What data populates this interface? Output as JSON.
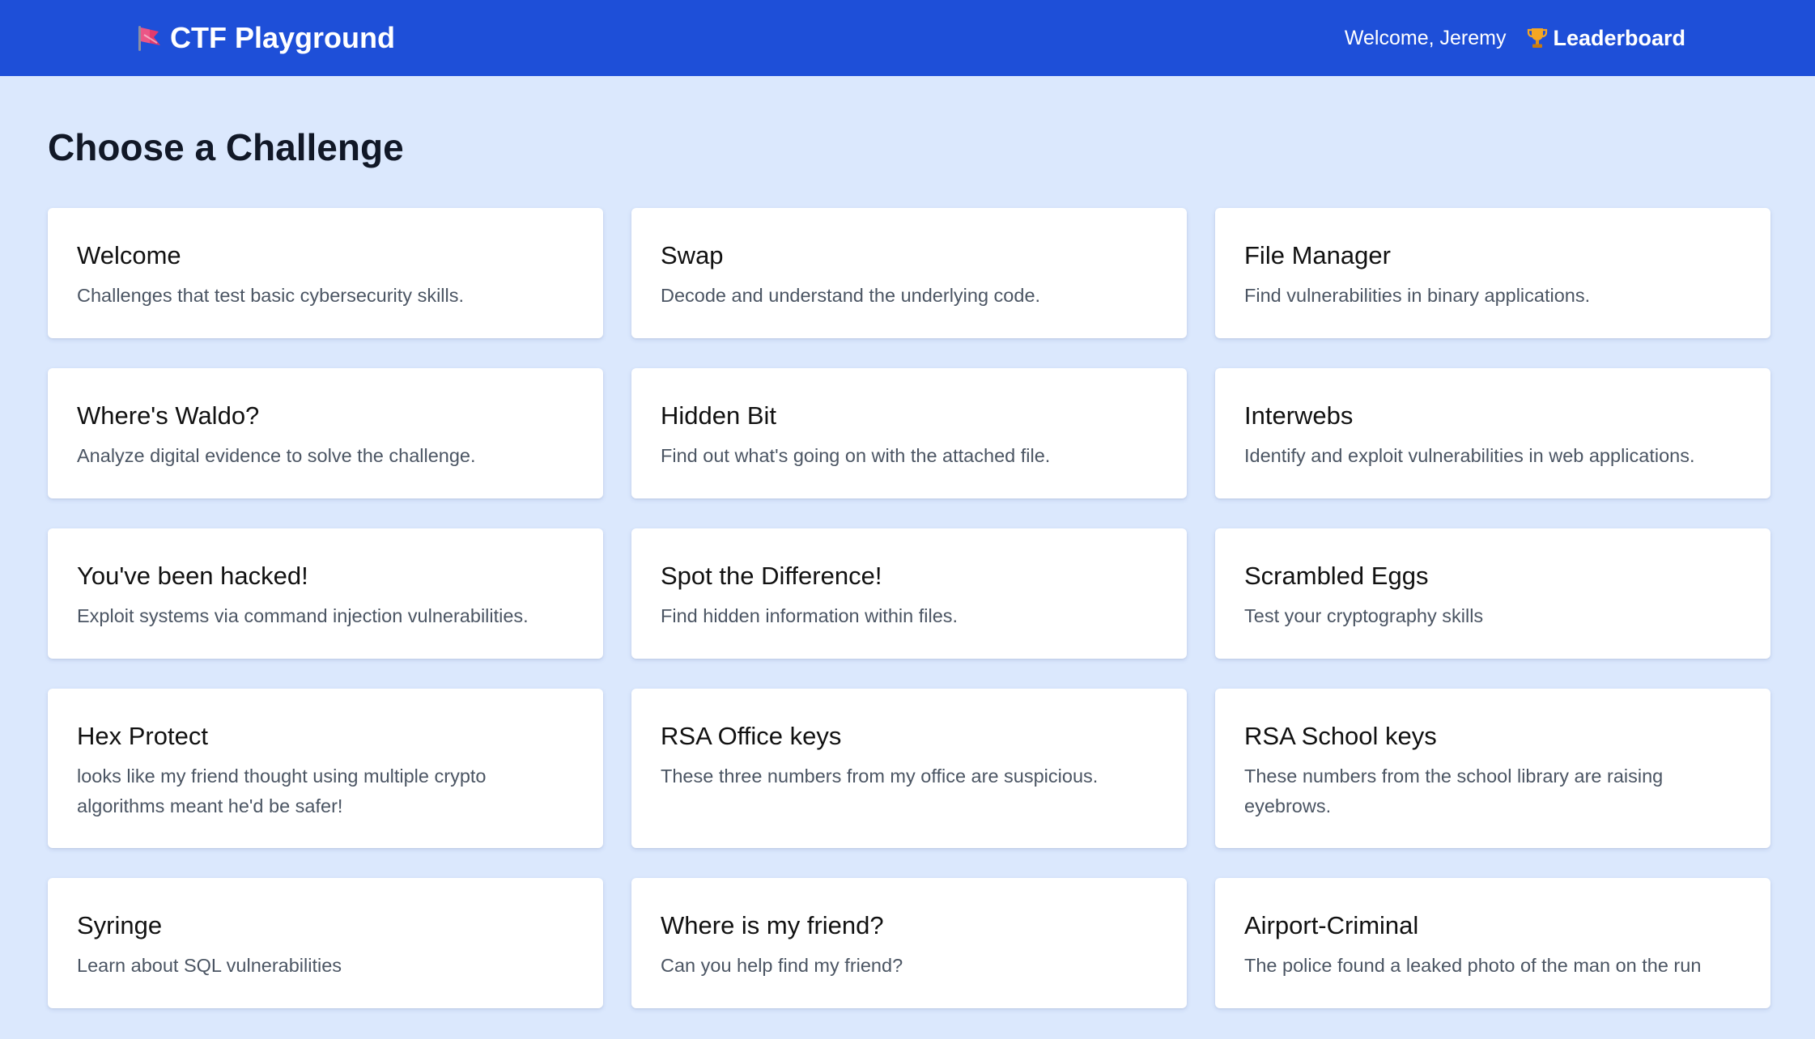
{
  "navbar": {
    "brand_icon": "flag-icon",
    "brand": "CTF Playground",
    "welcome": "Welcome, Jeremy",
    "leaderboard_icon": "trophy-icon",
    "leaderboard": "Leaderboard",
    "colors": {
      "background": "#1e4fd8",
      "text": "#ffffff"
    }
  },
  "page": {
    "title": "Choose a Challenge",
    "background": "#dbe8fd"
  },
  "challenges": [
    {
      "title": "Welcome",
      "description": "Challenges that test basic cybersecurity skills."
    },
    {
      "title": "Swap",
      "description": "Decode and understand the underlying code."
    },
    {
      "title": "File Manager",
      "description": "Find vulnerabilities in binary applications."
    },
    {
      "title": "Where's Waldo?",
      "description": "Analyze digital evidence to solve the challenge."
    },
    {
      "title": "Hidden Bit",
      "description": "Find out what's going on with the attached file."
    },
    {
      "title": "Interwebs",
      "description": "Identify and exploit vulnerabilities in web applications."
    },
    {
      "title": "You've been hacked!",
      "description": "Exploit systems via command injection vulnerabilities."
    },
    {
      "title": "Spot the Difference!",
      "description": "Find hidden information within files."
    },
    {
      "title": "Scrambled Eggs",
      "description": "Test your cryptography skills"
    },
    {
      "title": "Hex Protect",
      "description": "looks like my friend thought using multiple crypto algorithms meant he'd be safer!"
    },
    {
      "title": "RSA Office keys",
      "description": "These three numbers from my office are suspicious."
    },
    {
      "title": "RSA School keys",
      "description": "These numbers from the school library are raising eyebrows."
    },
    {
      "title": "Syringe",
      "description": "Learn about SQL vulnerabilities"
    },
    {
      "title": "Where is my friend?",
      "description": "Can you help find my friend?"
    },
    {
      "title": "Airport-Criminal",
      "description": "The police found a leaked photo of the man on the run"
    }
  ]
}
